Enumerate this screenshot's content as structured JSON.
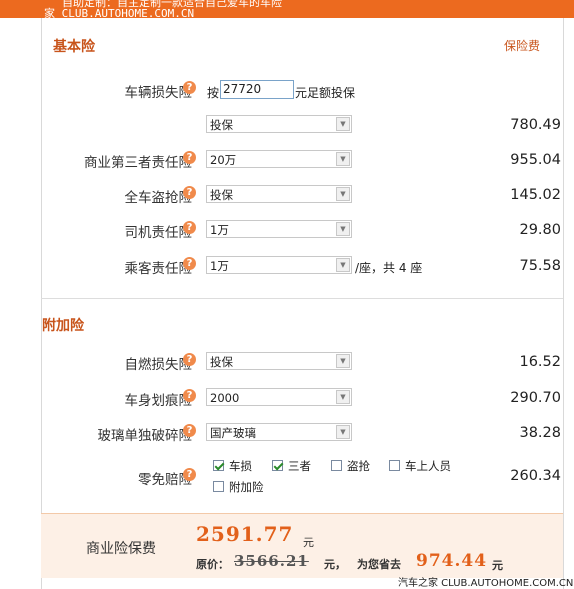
{
  "banner": {
    "line1": "自助定制：自主定制一款适合自己爱车的车险",
    "line2": "家 CLUB.AUTOHOME.COM.CN"
  },
  "basic": {
    "title": "基本险",
    "fee_header": "保险费",
    "vehicle_damage": {
      "label": "车辆损失险",
      "prefix": "按",
      "amount": "27720",
      "suffix": "元足额投保",
      "select": "投保",
      "fee": "780.49"
    },
    "third_party": {
      "label": "商业第三者责任险",
      "select": "20万",
      "fee": "955.04"
    },
    "theft": {
      "label": "全车盗抢险",
      "select": "投保",
      "fee": "145.02"
    },
    "driver": {
      "label": "司机责任险",
      "select": "1万",
      "fee": "29.80"
    },
    "passenger": {
      "label": "乘客责任险",
      "select": "1万",
      "unit": "/座，共 4 座",
      "fee": "75.58"
    }
  },
  "additional": {
    "title": "附加险",
    "self_ignition": {
      "label": "自燃损失险",
      "select": "投保",
      "fee": "16.52"
    },
    "scratch": {
      "label": "车身划痕险",
      "select": "2000",
      "fee": "290.70"
    },
    "glass": {
      "label": "玻璃单独破碎险",
      "select": "国产玻璃",
      "fee": "38.28"
    },
    "deductible": {
      "label": "零免赔险",
      "options": [
        {
          "label": "车损",
          "checked": true
        },
        {
          "label": "三者",
          "checked": true
        },
        {
          "label": "盗抢",
          "checked": false
        },
        {
          "label": "车上人员",
          "checked": false
        },
        {
          "label": "附加险",
          "checked": false
        }
      ],
      "fee": "260.34"
    }
  },
  "summary": {
    "label": "商业险保费",
    "total": "2591.77",
    "yuan": "元",
    "orig_label": "原价：",
    "orig_price": "3566.21",
    "orig_unit": "元，",
    "save_label": "为您省去",
    "save_amount": "974.44",
    "save_unit": "元"
  },
  "watermark": "汽车之家 CLUB.AUTOHOME.COM.CN",
  "icons": {
    "help": "question-mark-icon",
    "dropdown": "chevron-down-icon",
    "checkbox": "checkbox-icon"
  },
  "colors": {
    "accent": "#ec6a1f",
    "section_title": "#c8541b",
    "summary_bg": "#fdf0e6",
    "price": "#e2601a"
  }
}
